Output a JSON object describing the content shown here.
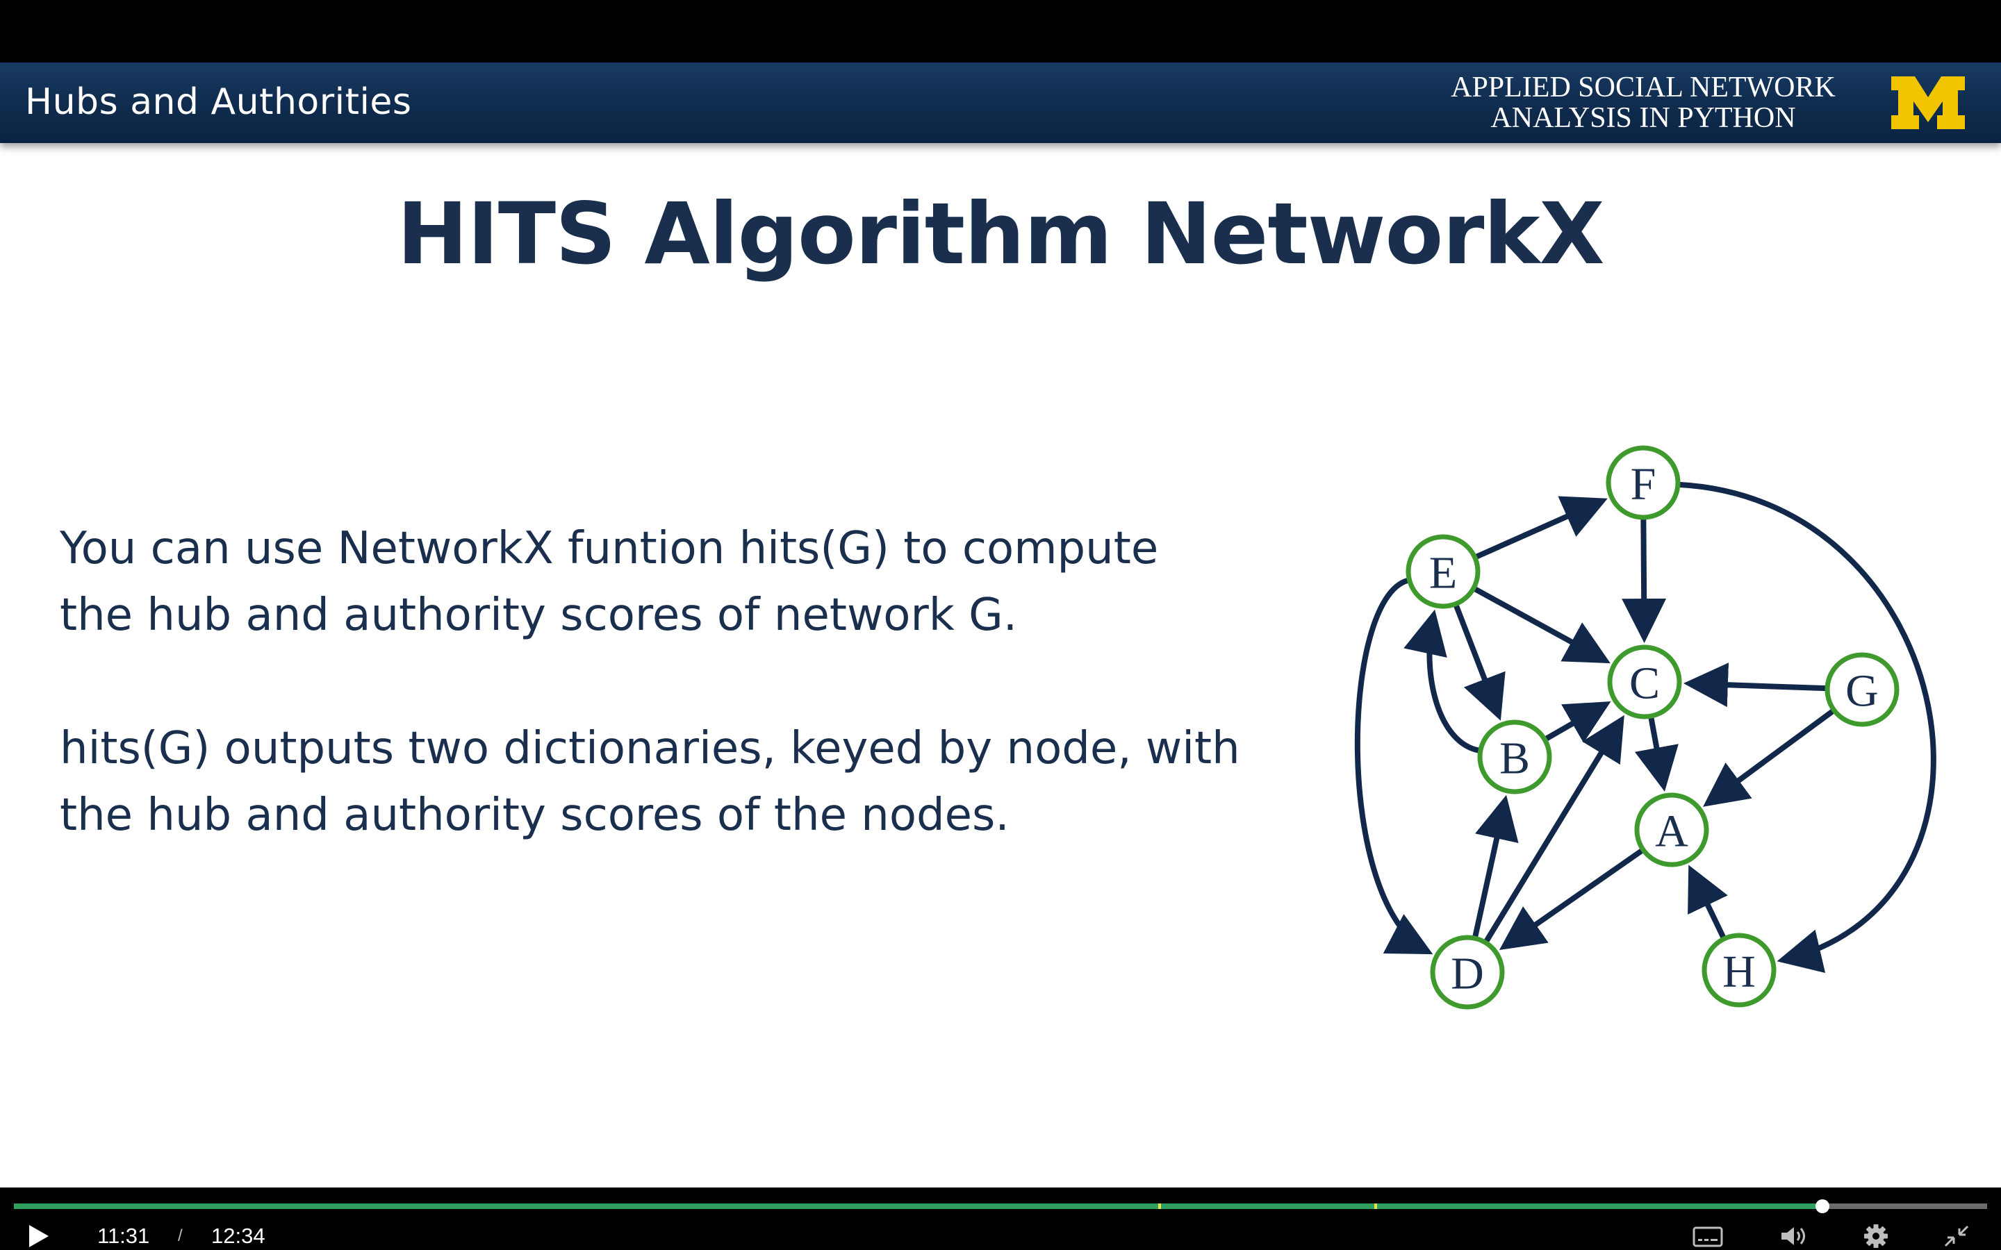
{
  "slide": {
    "section_title": "Hubs and Authorities",
    "course_title_line1": "APPLIED SOCIAL NETWORK",
    "course_title_line2": "ANALYSIS IN PYTHON",
    "logo_letter": "M",
    "title": "HITS Algorithm NetworkX",
    "paragraph1_line1": "You can use NetworkX funtion hits(G) to compute",
    "paragraph1_line2": "the hub and authority scores of network G.",
    "paragraph2_line1": "hits(G) outputs two dictionaries, keyed by node, with",
    "paragraph2_line2": "the hub and authority scores of the nodes."
  },
  "graph": {
    "nodes": [
      "A",
      "B",
      "C",
      "D",
      "E",
      "F",
      "G",
      "H"
    ],
    "edges": [
      [
        "E",
        "F"
      ],
      [
        "F",
        "C"
      ],
      [
        "F",
        "H"
      ],
      [
        "E",
        "C"
      ],
      [
        "E",
        "B"
      ],
      [
        "B",
        "E"
      ],
      [
        "B",
        "C"
      ],
      [
        "E",
        "D"
      ],
      [
        "G",
        "C"
      ],
      [
        "G",
        "A"
      ],
      [
        "C",
        "A"
      ],
      [
        "D",
        "B"
      ],
      [
        "D",
        "C"
      ],
      [
        "A",
        "D"
      ],
      [
        "H",
        "A"
      ]
    ],
    "node_stroke_color": "#3f9a2e",
    "edge_color": "#12284a"
  },
  "player": {
    "current_time": "11:31",
    "separator": "/",
    "total_time": "12:34",
    "progress": 0.9167,
    "played_color": "#2fa060",
    "icons": {
      "play": "play-icon",
      "captions": "captions-icon",
      "volume": "volume-icon",
      "settings": "gear-icon",
      "exit_fullscreen": "exit-fullscreen-icon"
    }
  },
  "colors": {
    "header_bg": "#0f2b4d",
    "title_text": "#1a2f4e",
    "logo_maize": "#f2c400"
  }
}
